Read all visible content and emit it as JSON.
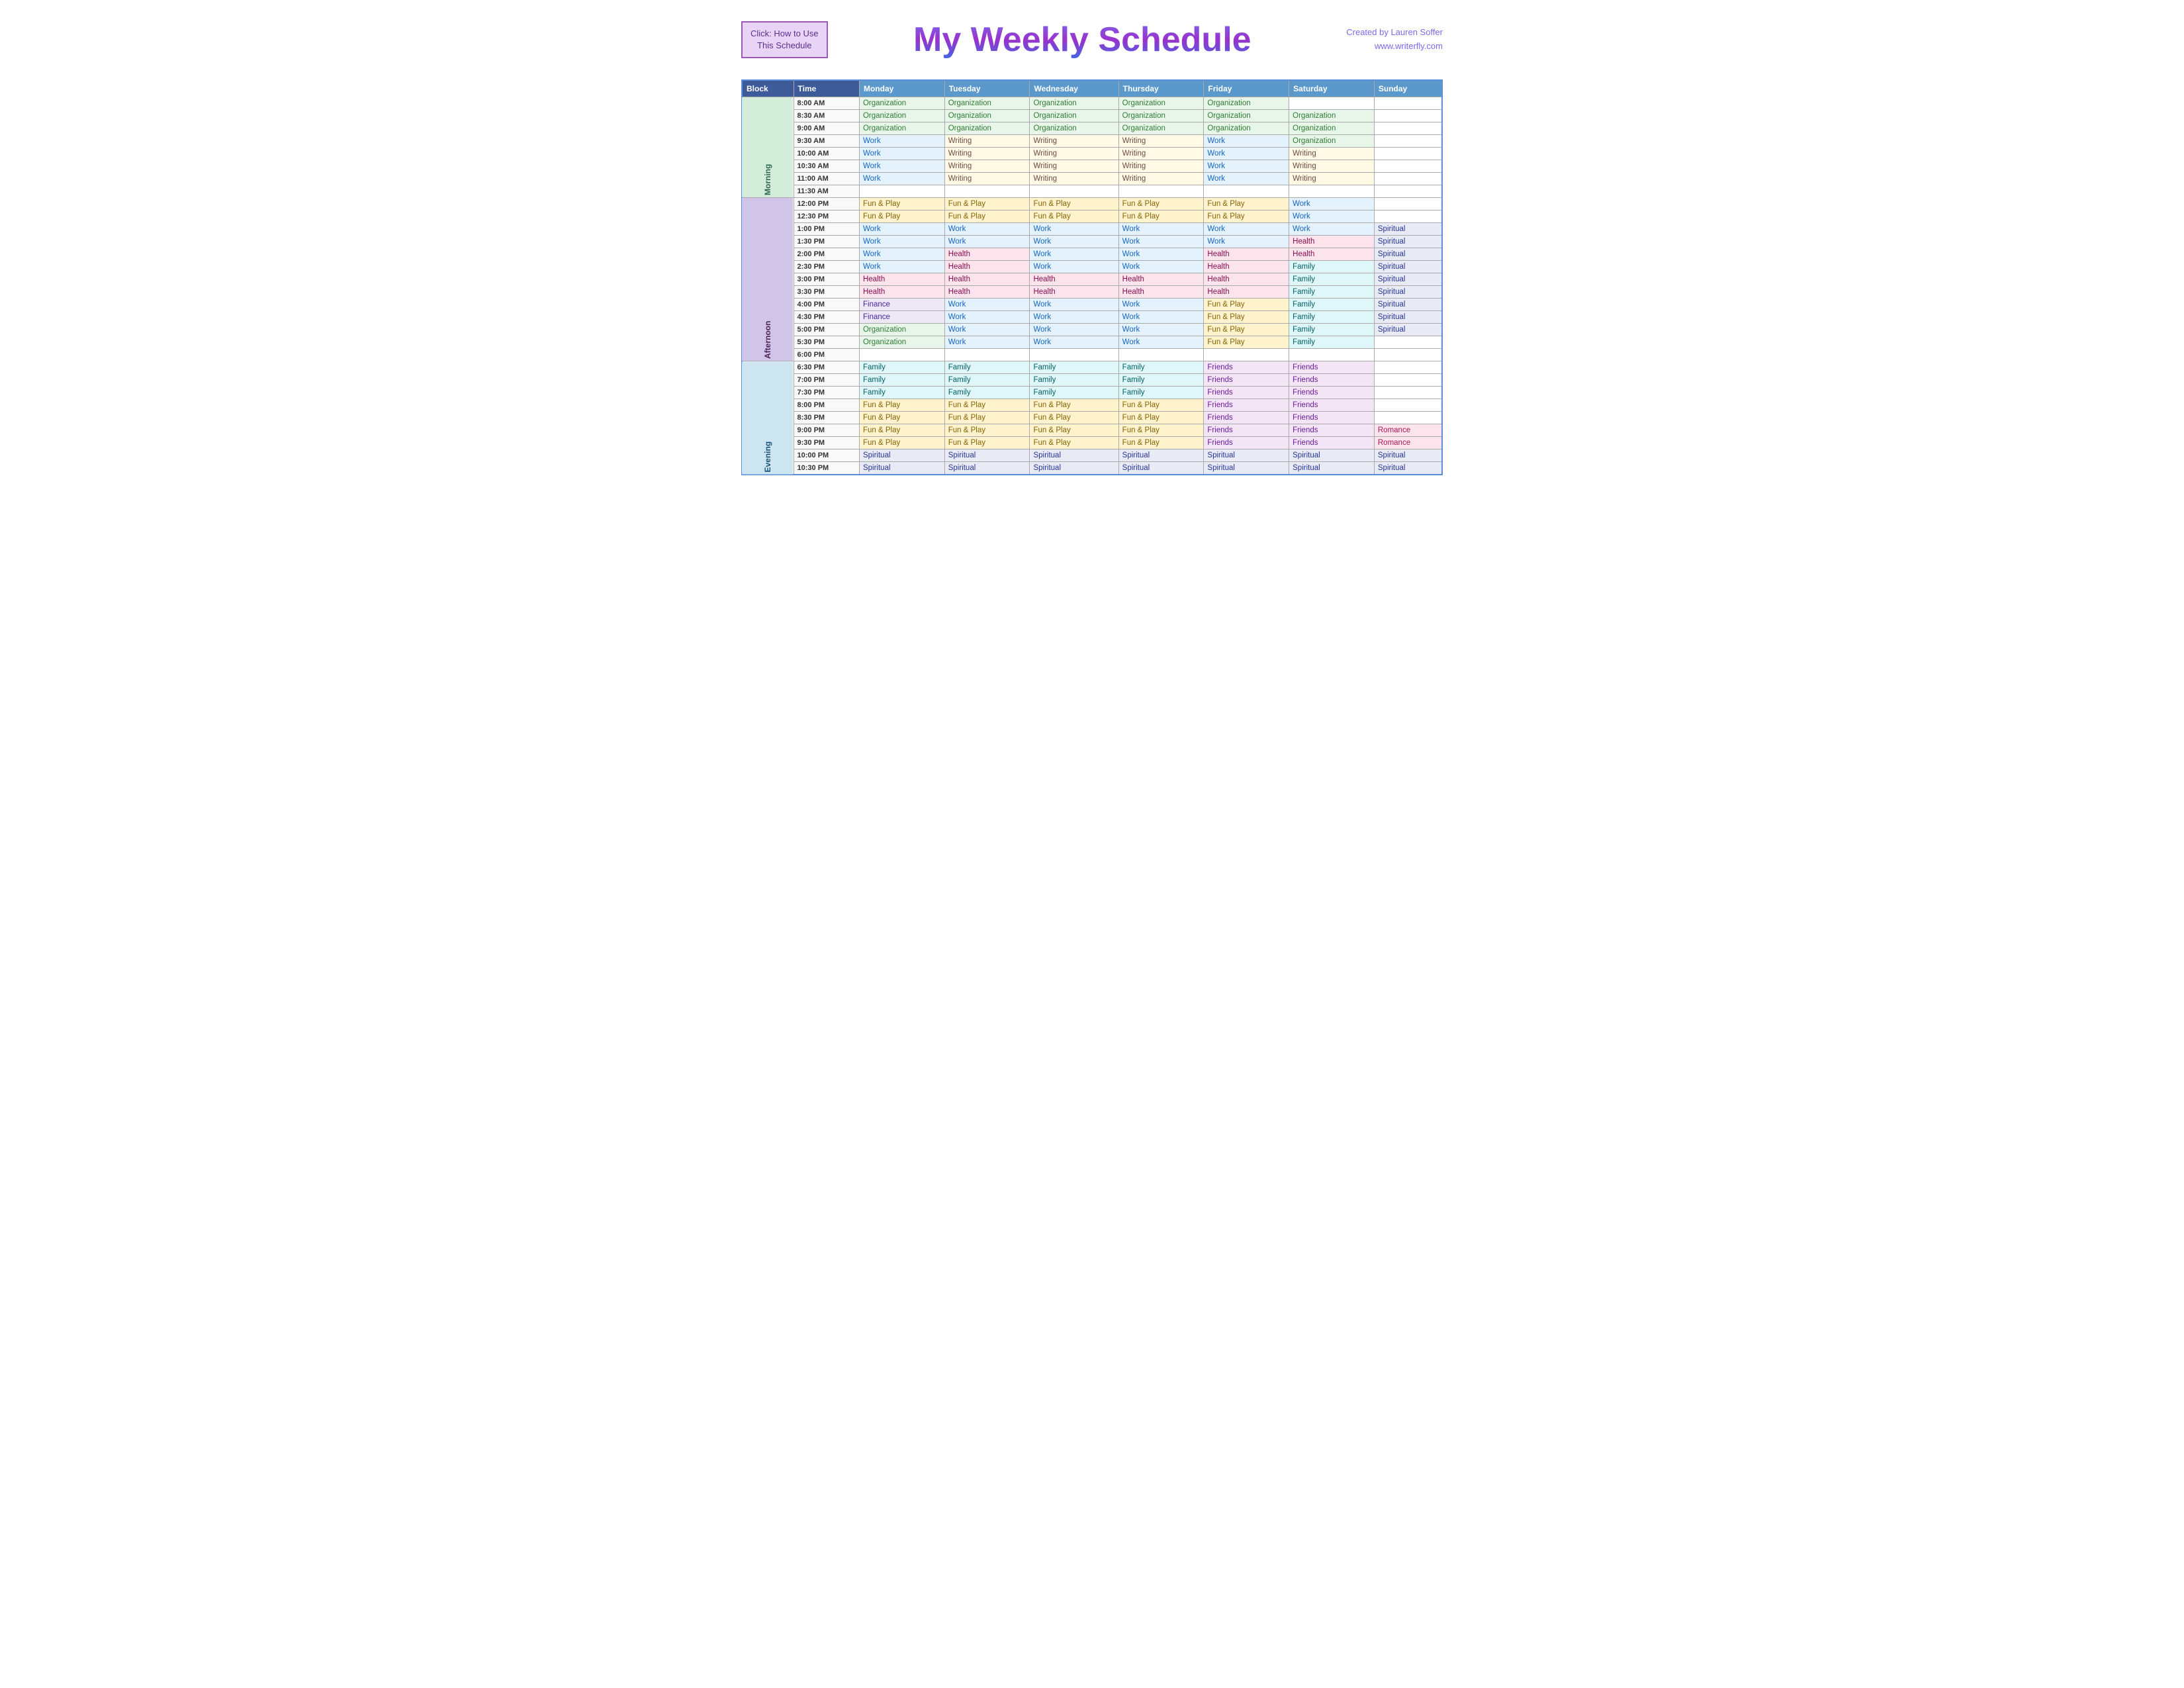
{
  "header": {
    "click_box_line1": "Click:  How to Use",
    "click_box_line2": "This Schedule",
    "title": "My Weekly Schedule",
    "credit_line1": "Created by Lauren Soffer",
    "credit_line2": "www.writerfly.com"
  },
  "table": {
    "columns": [
      "Block",
      "Time",
      "Monday",
      "Tuesday",
      "Wednesday",
      "Thursday",
      "Friday",
      "Saturday",
      "Sunday"
    ],
    "blocks": {
      "morning": "Morning",
      "afternoon": "Afternoon",
      "evening": "Evening"
    },
    "rows": [
      {
        "block": "morning",
        "time": "8:00 AM",
        "mon": "Organization",
        "tue": "Organization",
        "wed": "Organization",
        "thu": "Organization",
        "fri": "Organization",
        "sat": "",
        "sun": ""
      },
      {
        "block": "morning",
        "time": "8:30 AM",
        "mon": "Organization",
        "tue": "Organization",
        "wed": "Organization",
        "thu": "Organization",
        "fri": "Organization",
        "sat": "Organization",
        "sun": ""
      },
      {
        "block": "morning",
        "time": "9:00 AM",
        "mon": "Organization",
        "tue": "Organization",
        "wed": "Organization",
        "thu": "Organization",
        "fri": "Organization",
        "sat": "Organization",
        "sun": ""
      },
      {
        "block": "morning",
        "time": "9:30 AM",
        "mon": "Work",
        "tue": "Writing",
        "wed": "Writing",
        "thu": "Writing",
        "fri": "Work",
        "sat": "Organization",
        "sun": ""
      },
      {
        "block": "morning",
        "time": "10:00 AM",
        "mon": "Work",
        "tue": "Writing",
        "wed": "Writing",
        "thu": "Writing",
        "fri": "Work",
        "sat": "Writing",
        "sun": ""
      },
      {
        "block": "morning",
        "time": "10:30 AM",
        "mon": "Work",
        "tue": "Writing",
        "wed": "Writing",
        "thu": "Writing",
        "fri": "Work",
        "sat": "Writing",
        "sun": ""
      },
      {
        "block": "morning",
        "time": "11:00 AM",
        "mon": "Work",
        "tue": "Writing",
        "wed": "Writing",
        "thu": "Writing",
        "fri": "Work",
        "sat": "Writing",
        "sun": ""
      },
      {
        "block": "morning",
        "time": "11:30 AM",
        "mon": "",
        "tue": "",
        "wed": "",
        "thu": "",
        "fri": "",
        "sat": "",
        "sun": ""
      },
      {
        "block": "afternoon",
        "time": "12:00 PM",
        "mon": "Fun & Play",
        "tue": "Fun & Play",
        "wed": "Fun & Play",
        "thu": "Fun & Play",
        "fri": "Fun & Play",
        "sat": "Work",
        "sun": ""
      },
      {
        "block": "afternoon",
        "time": "12:30 PM",
        "mon": "Fun & Play",
        "tue": "Fun & Play",
        "wed": "Fun & Play",
        "thu": "Fun & Play",
        "fri": "Fun & Play",
        "sat": "Work",
        "sun": ""
      },
      {
        "block": "afternoon",
        "time": "1:00 PM",
        "mon": "Work",
        "tue": "Work",
        "wed": "Work",
        "thu": "Work",
        "fri": "Work",
        "sat": "Work",
        "sun": "Spiritual"
      },
      {
        "block": "afternoon",
        "time": "1:30 PM",
        "mon": "Work",
        "tue": "Work",
        "wed": "Work",
        "thu": "Work",
        "fri": "Work",
        "sat": "Health",
        "sun": "Spiritual"
      },
      {
        "block": "afternoon",
        "time": "2:00 PM",
        "mon": "Work",
        "tue": "Health",
        "wed": "Work",
        "thu": "Work",
        "fri": "Health",
        "sat": "Health",
        "sun": "Spiritual"
      },
      {
        "block": "afternoon",
        "time": "2:30 PM",
        "mon": "Work",
        "tue": "Health",
        "wed": "Work",
        "thu": "Work",
        "fri": "Health",
        "sat": "Family",
        "sun": "Spiritual"
      },
      {
        "block": "afternoon",
        "time": "3:00 PM",
        "mon": "Health",
        "tue": "Health",
        "wed": "Health",
        "thu": "Health",
        "fri": "Health",
        "sat": "Family",
        "sun": "Spiritual"
      },
      {
        "block": "afternoon",
        "time": "3:30 PM",
        "mon": "Health",
        "tue": "Health",
        "wed": "Health",
        "thu": "Health",
        "fri": "Health",
        "sat": "Family",
        "sun": "Spiritual"
      },
      {
        "block": "afternoon",
        "time": "4:00 PM",
        "mon": "Finance",
        "tue": "Work",
        "wed": "Work",
        "thu": "Work",
        "fri": "Fun & Play",
        "sat": "Family",
        "sun": "Spiritual"
      },
      {
        "block": "afternoon",
        "time": "4:30 PM",
        "mon": "Finance",
        "tue": "Work",
        "wed": "Work",
        "thu": "Work",
        "fri": "Fun & Play",
        "sat": "Family",
        "sun": "Spiritual"
      },
      {
        "block": "afternoon",
        "time": "5:00 PM",
        "mon": "Organization",
        "tue": "Work",
        "wed": "Work",
        "thu": "Work",
        "fri": "Fun & Play",
        "sat": "Family",
        "sun": "Spiritual"
      },
      {
        "block": "afternoon",
        "time": "5:30 PM",
        "mon": "Organization",
        "tue": "Work",
        "wed": "Work",
        "thu": "Work",
        "fri": "Fun & Play",
        "sat": "Family",
        "sun": ""
      },
      {
        "block": "afternoon",
        "time": "6:00 PM",
        "mon": "",
        "tue": "",
        "wed": "",
        "thu": "",
        "fri": "",
        "sat": "",
        "sun": ""
      },
      {
        "block": "evening",
        "time": "6:30 PM",
        "mon": "Family",
        "tue": "Family",
        "wed": "Family",
        "thu": "Family",
        "fri": "Friends",
        "sat": "Friends",
        "sun": ""
      },
      {
        "block": "evening",
        "time": "7:00 PM",
        "mon": "Family",
        "tue": "Family",
        "wed": "Family",
        "thu": "Family",
        "fri": "Friends",
        "sat": "Friends",
        "sun": ""
      },
      {
        "block": "evening",
        "time": "7:30 PM",
        "mon": "Family",
        "tue": "Family",
        "wed": "Family",
        "thu": "Family",
        "fri": "Friends",
        "sat": "Friends",
        "sun": ""
      },
      {
        "block": "evening",
        "time": "8:00 PM",
        "mon": "Fun & Play",
        "tue": "Fun & Play",
        "wed": "Fun & Play",
        "thu": "Fun & Play",
        "fri": "Friends",
        "sat": "Friends",
        "sun": ""
      },
      {
        "block": "evening",
        "time": "8:30 PM",
        "mon": "Fun & Play",
        "tue": "Fun & Play",
        "wed": "Fun & Play",
        "thu": "Fun & Play",
        "fri": "Friends",
        "sat": "Friends",
        "sun": ""
      },
      {
        "block": "evening",
        "time": "9:00 PM",
        "mon": "Fun & Play",
        "tue": "Fun & Play",
        "wed": "Fun & Play",
        "thu": "Fun & Play",
        "fri": "Friends",
        "sat": "Friends",
        "sun": "Romance"
      },
      {
        "block": "evening",
        "time": "9:30 PM",
        "mon": "Fun & Play",
        "tue": "Fun & Play",
        "wed": "Fun & Play",
        "thu": "Fun & Play",
        "fri": "Friends",
        "sat": "Friends",
        "sun": "Romance"
      },
      {
        "block": "evening",
        "time": "10:00 PM",
        "mon": "Spiritual",
        "tue": "Spiritual",
        "wed": "Spiritual",
        "thu": "Spiritual",
        "fri": "Spiritual",
        "sat": "Spiritual",
        "sun": "Spiritual"
      },
      {
        "block": "evening",
        "time": "10:30 PM",
        "mon": "Spiritual",
        "tue": "Spiritual",
        "wed": "Spiritual",
        "thu": "Spiritual",
        "fri": "Spiritual",
        "sat": "Spiritual",
        "sun": "Spiritual"
      }
    ]
  }
}
